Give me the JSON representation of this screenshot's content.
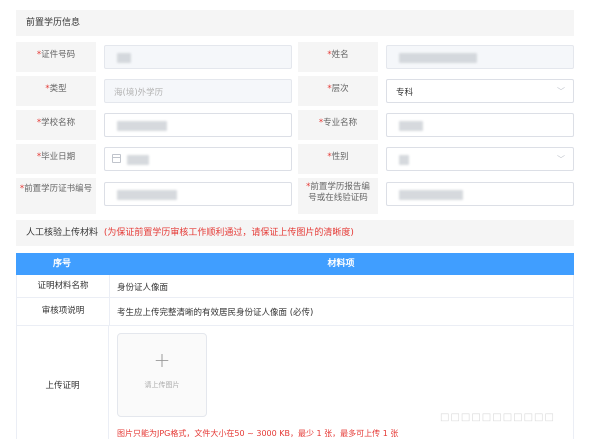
{
  "section_prior": {
    "title": "前置学历信息"
  },
  "fields": {
    "id_number": {
      "label": "证件号码"
    },
    "name": {
      "label": "姓名"
    },
    "type": {
      "label": "类型",
      "value": "海(境)外学历"
    },
    "level": {
      "label": "层次",
      "value": "专科"
    },
    "school": {
      "label": "学校名称"
    },
    "major": {
      "label": "专业名称"
    },
    "grad_date": {
      "label": "毕业日期"
    },
    "gender": {
      "label": "性别"
    },
    "cert_no": {
      "label": "前置学历证书编号"
    },
    "report_no": {
      "label": "前置学历报告编号或在线验证码"
    }
  },
  "section_upload": {
    "title": "人工核验上传材料",
    "note": "(为保证前置学历审核工作顺利通过，请保证上传图片的清晰度)"
  },
  "table": {
    "headers": [
      "序号",
      "材料项"
    ],
    "rows": [
      {
        "key": "证明材料名称",
        "value": "身份证人像面"
      },
      {
        "key": "审核项说明",
        "value": "考生应上传完整清晰的有效居民身份证人像面 (必传)"
      },
      {
        "key": "上传证明",
        "value": ""
      }
    ],
    "upload": {
      "plus": "+",
      "label": "请上传图片",
      "hint": "图片只能为JPG格式，文件大小在50 ~ 3000 KB，最少 1 张，最多可上传 1 张"
    }
  },
  "watermark": "□□□□□□□□□□□",
  "colors": {
    "accent": "#409eff",
    "required": "#e53935",
    "note": "#e53935"
  }
}
